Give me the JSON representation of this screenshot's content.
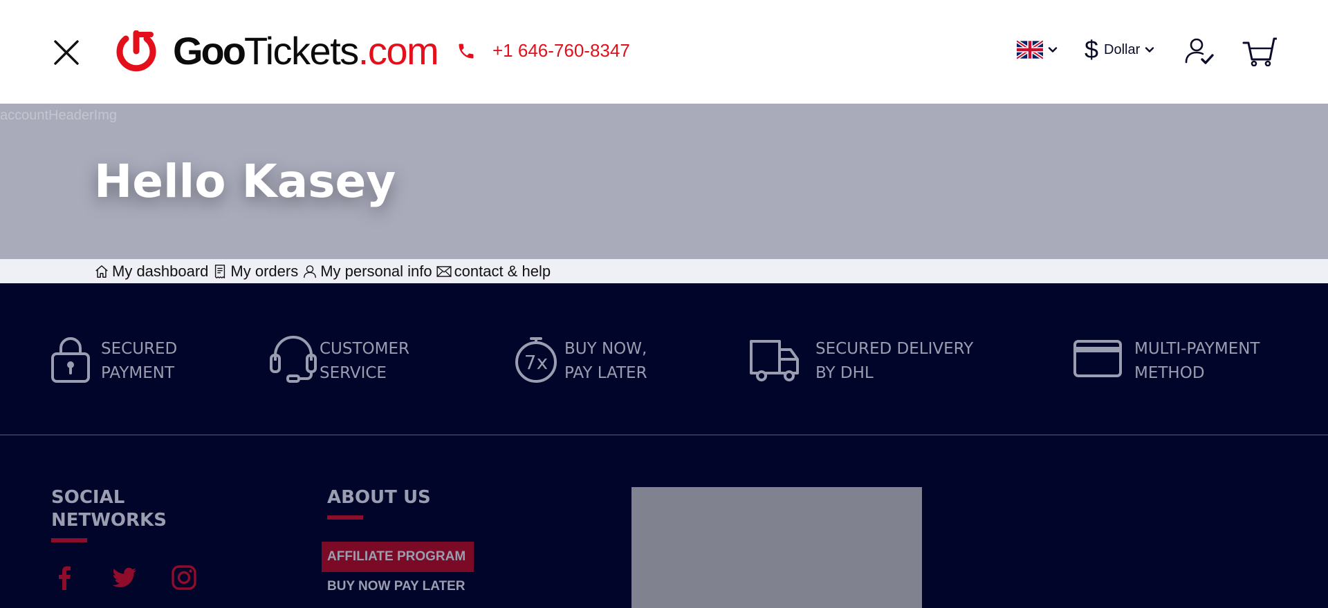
{
  "header": {
    "logo": {
      "part1": "Goo",
      "part2": "Tickets",
      "part3": ".com"
    },
    "phone": "+1 646-760-8347",
    "currency": {
      "symbol": "$",
      "label": "Dollar"
    },
    "icons": {
      "close": "close-icon",
      "phone": "phone-icon",
      "flag": "uk-flag-icon",
      "account": "user-check-icon",
      "cart": "cart-icon"
    }
  },
  "hero": {
    "image_alt": "accountHeaderImg",
    "greeting": "Hello",
    "name": "Kasey"
  },
  "tabs": [
    {
      "label": "My dashboard",
      "icon": "home-icon"
    },
    {
      "label": "My orders",
      "icon": "receipt-icon"
    },
    {
      "label": "My personal info",
      "icon": "user-icon"
    },
    {
      "label": "contact & help",
      "icon": "envelope-icon"
    }
  ],
  "features": [
    {
      "text": "SECURED\nPAYMENT",
      "icon": "lock-icon"
    },
    {
      "text": "CUSTOMER\nSERVICE",
      "icon": "headset-icon"
    },
    {
      "text": "BUY NOW,\nPAY LATER",
      "icon": "timer-7x-icon",
      "icon_label": "7x"
    },
    {
      "text": "SECURED DELIVERY\nBY DHL",
      "icon": "truck-icon"
    },
    {
      "text": "MULTI-PAYMENT\nMETHOD",
      "icon": "credit-card-icon"
    }
  ],
  "footer": {
    "social": {
      "title": "SOCIAL\nNETWORKS",
      "icons": [
        "facebook-icon",
        "twitter-icon",
        "instagram-icon"
      ]
    },
    "about": {
      "title": "ABOUT US",
      "links": [
        "AFFILIATE PROGRAM",
        "BUY NOW PAY LATER"
      ]
    }
  },
  "colors": {
    "brand_red": "#e3101b",
    "footer_bg": "#02052a",
    "hero_bg": "#a9abbb",
    "accent_dark_red": "#7b0a26",
    "muted_text": "#9b9db1"
  }
}
